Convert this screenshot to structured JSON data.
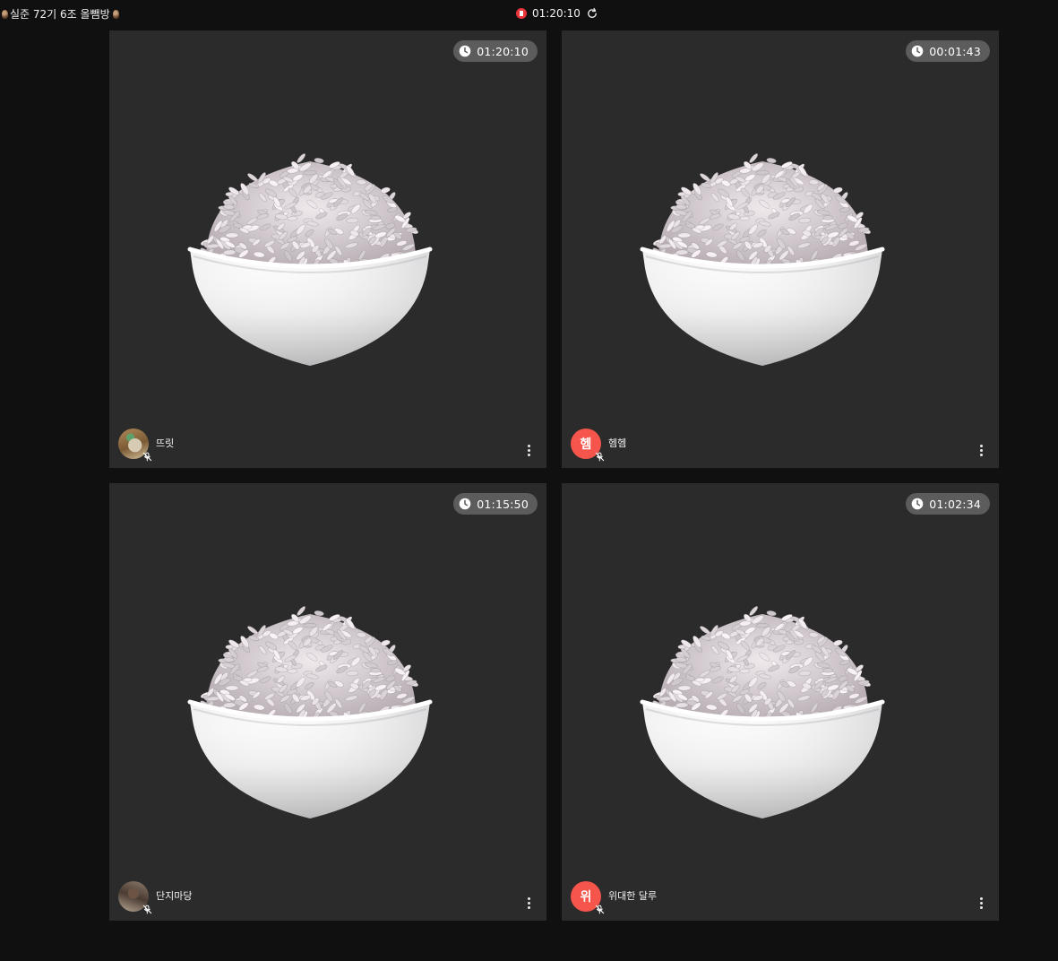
{
  "header": {
    "room_title": "실준 72기 6조 올뺌방",
    "title_emoji": "owl-emoji",
    "session_time": "01:20:10",
    "recording_status": "paused",
    "refresh_icon": "refresh-icon"
  },
  "colors": {
    "page_background": "#101010",
    "tile_background": "#2b2b2b",
    "badge_background": "#5c5c5c",
    "avatar_letter_background": "#f5554a",
    "recording_dot": "#e8353a"
  },
  "tiles": [
    {
      "timer": "01:20:10",
      "name": "뜨릿",
      "avatar": {
        "type": "photo",
        "letter": ""
      },
      "mic": "muted",
      "video_placeholder": "rice-bowl-emoji"
    },
    {
      "timer": "00:01:43",
      "name": "헴헴",
      "avatar": {
        "type": "letter",
        "letter": "헴"
      },
      "mic": "muted",
      "video_placeholder": "rice-bowl-emoji"
    },
    {
      "timer": "01:15:50",
      "name": "단지마당",
      "avatar": {
        "type": "photo",
        "letter": ""
      },
      "mic": "muted",
      "video_placeholder": "rice-bowl-emoji"
    },
    {
      "timer": "01:02:34",
      "name": "위대한 달루",
      "avatar": {
        "type": "letter",
        "letter": "위"
      },
      "mic": "muted",
      "video_placeholder": "rice-bowl-emoji"
    }
  ]
}
